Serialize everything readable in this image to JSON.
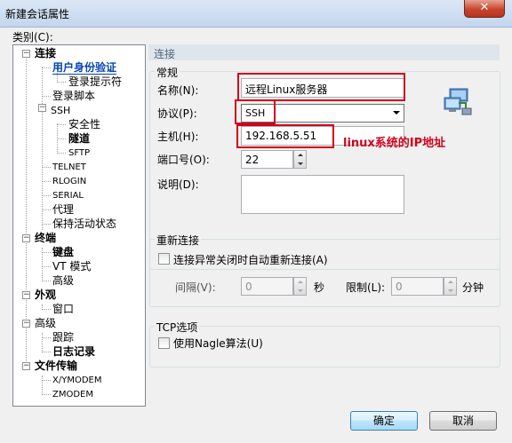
{
  "window": {
    "title": "新建会话属性",
    "close_label": "✕"
  },
  "category_label": "类别(C):",
  "tree": {
    "connection": "连接",
    "user_auth": "用户身份验证",
    "login_prompt": "登录提示符",
    "login_script": "登录脚本",
    "ssh": "SSH",
    "security": "安全性",
    "tunnel": "隧道",
    "sftp": "SFTP",
    "telnet": "TELNET",
    "rlogin": "RLOGIN",
    "serial": "SERIAL",
    "proxy": "代理",
    "keepalive": "保持活动状态",
    "terminal": "终端",
    "keyboard": "键盘",
    "vt_mode": "VT 模式",
    "advanced_term": "高级",
    "appearance": "外观",
    "window": "窗口",
    "advanced": "高级",
    "trace": "跟踪",
    "logging": "日志记录",
    "file_transfer": "文件传输",
    "xymodem": "X/YMODEM",
    "zmodem": "ZMODEM"
  },
  "panel": {
    "header": "连接",
    "general": {
      "title": "常规",
      "name_label": "名称(N):",
      "name_value": "远程Linux服务器",
      "protocol_label": "协议(P):",
      "protocol_value": "SSH",
      "host_label": "主机(H):",
      "host_value": "192.168.5.51",
      "port_label": "端口号(O):",
      "port_value": "22",
      "desc_label": "说明(D):",
      "desc_value": ""
    },
    "reconnect": {
      "title": "重新连接",
      "auto_label": "连接异常关闭时自动重新连接(A)",
      "interval_label": "间隔(V):",
      "interval_value": "0",
      "sec_unit": "秒",
      "limit_label": "限制(L):",
      "limit_value": "0",
      "min_unit": "分钟"
    },
    "tcp": {
      "title": "TCP选项",
      "nagle_label": "使用Nagle算法(U)"
    }
  },
  "annotation": {
    "host_note": "linux系统的IP地址",
    "color": "#d0021b"
  },
  "buttons": {
    "ok": "确定",
    "cancel": "取消"
  }
}
